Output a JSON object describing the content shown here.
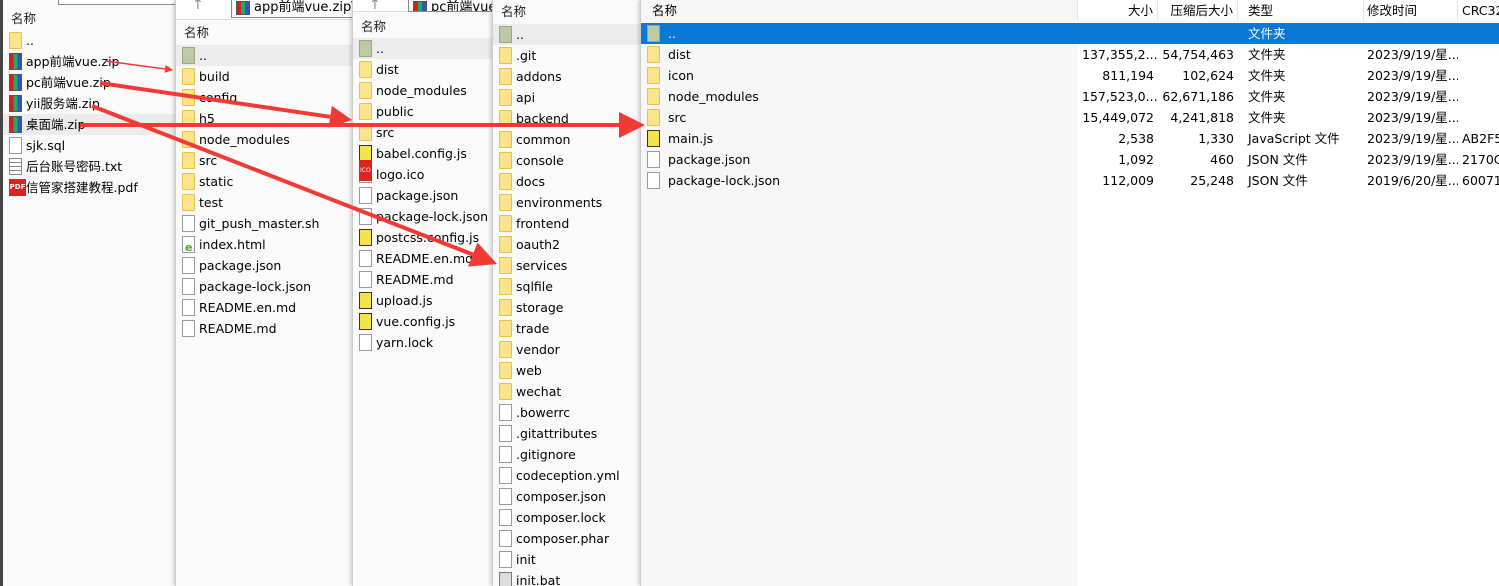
{
  "panels": [
    {
      "header": "名称",
      "items": [
        {
          "name": "..",
          "icon": "up-folder"
        },
        {
          "name": "app前端vue.zip",
          "icon": "zip"
        },
        {
          "name": "pc前端vue.zip",
          "icon": "zip"
        },
        {
          "name": "yii服务端.zip",
          "icon": "zip"
        },
        {
          "name": "桌面端.zip",
          "icon": "zip",
          "highlight": true
        },
        {
          "name": "sjk.sql",
          "icon": "file"
        },
        {
          "name": "后台账号密码.txt",
          "icon": "txt"
        },
        {
          "name": "信管家搭建教程.pdf",
          "icon": "pdf"
        }
      ]
    },
    {
      "header": "名称",
      "address": "app前端vue.zip\\a",
      "items": [
        {
          "name": "..",
          "icon": "up"
        },
        {
          "name": "build",
          "icon": "folder"
        },
        {
          "name": "config",
          "icon": "folder"
        },
        {
          "name": "h5",
          "icon": "folder"
        },
        {
          "name": "node_modules",
          "icon": "folder"
        },
        {
          "name": "src",
          "icon": "folder"
        },
        {
          "name": "static",
          "icon": "folder"
        },
        {
          "name": "test",
          "icon": "folder"
        },
        {
          "name": "git_push_master.sh",
          "icon": "file"
        },
        {
          "name": "index.html",
          "icon": "html"
        },
        {
          "name": "package.json",
          "icon": "file"
        },
        {
          "name": "package-lock.json",
          "icon": "file"
        },
        {
          "name": "README.en.md",
          "icon": "file"
        },
        {
          "name": "README.md",
          "icon": "file"
        }
      ]
    },
    {
      "header": "名称",
      "address": "pc前端vue",
      "items": [
        {
          "name": "..",
          "icon": "up"
        },
        {
          "name": "dist",
          "icon": "folder"
        },
        {
          "name": "node_modules",
          "icon": "folder"
        },
        {
          "name": "public",
          "icon": "folder"
        },
        {
          "name": "src",
          "icon": "folder"
        },
        {
          "name": "babel.config.js",
          "icon": "js"
        },
        {
          "name": "logo.ico",
          "icon": "ico"
        },
        {
          "name": "package.json",
          "icon": "file"
        },
        {
          "name": "package-lock.json",
          "icon": "file"
        },
        {
          "name": "postcss.config.js",
          "icon": "js"
        },
        {
          "name": "README.en.md",
          "icon": "file"
        },
        {
          "name": "README.md",
          "icon": "file"
        },
        {
          "name": "upload.js",
          "icon": "js"
        },
        {
          "name": "vue.config.js",
          "icon": "js"
        },
        {
          "name": "yarn.lock",
          "icon": "file"
        }
      ]
    },
    {
      "header": "名称",
      "items": [
        {
          "name": "..",
          "icon": "up"
        },
        {
          "name": ".git",
          "icon": "folder"
        },
        {
          "name": "addons",
          "icon": "folder"
        },
        {
          "name": "api",
          "icon": "folder"
        },
        {
          "name": "backend",
          "icon": "folder"
        },
        {
          "name": "common",
          "icon": "folder"
        },
        {
          "name": "console",
          "icon": "folder"
        },
        {
          "name": "docs",
          "icon": "folder"
        },
        {
          "name": "environments",
          "icon": "folder"
        },
        {
          "name": "frontend",
          "icon": "folder"
        },
        {
          "name": "oauth2",
          "icon": "folder"
        },
        {
          "name": "services",
          "icon": "folder"
        },
        {
          "name": "sqlfile",
          "icon": "folder"
        },
        {
          "name": "storage",
          "icon": "folder"
        },
        {
          "name": "trade",
          "icon": "folder"
        },
        {
          "name": "vendor",
          "icon": "folder"
        },
        {
          "name": "web",
          "icon": "folder"
        },
        {
          "name": "wechat",
          "icon": "folder"
        },
        {
          "name": ".bowerrc",
          "icon": "file"
        },
        {
          "name": ".gitattributes",
          "icon": "file"
        },
        {
          "name": ".gitignore",
          "icon": "file"
        },
        {
          "name": "codeception.yml",
          "icon": "file"
        },
        {
          "name": "composer.json",
          "icon": "file"
        },
        {
          "name": "composer.lock",
          "icon": "file"
        },
        {
          "name": "composer.phar",
          "icon": "file"
        },
        {
          "name": "init",
          "icon": "file"
        },
        {
          "name": "init.bat",
          "icon": "bat"
        }
      ]
    }
  ],
  "detail": {
    "columns": [
      "名称",
      "大小",
      "压缩后大小",
      "类型",
      "修改时间",
      "CRC32"
    ],
    "rows": [
      [
        "..",
        "",
        "",
        "文件夹",
        "",
        ""
      ],
      [
        "dist",
        "137,355,2...",
        "54,754,463",
        "文件夹",
        "2023/9/19/星...",
        ""
      ],
      [
        "icon",
        "811,194",
        "102,624",
        "文件夹",
        "2023/9/19/星...",
        ""
      ],
      [
        "node_modules",
        "157,523,0...",
        "62,671,186",
        "文件夹",
        "2023/9/19/星...",
        ""
      ],
      [
        "src",
        "15,449,072",
        "4,241,818",
        "文件夹",
        "2023/9/19/星...",
        ""
      ],
      [
        "main.js",
        "2,538",
        "1,330",
        "JavaScript 文件",
        "2023/9/19/星...",
        "AB2F5"
      ],
      [
        "package.json",
        "1,092",
        "460",
        "JSON 文件",
        "2023/9/19/星...",
        "2170C"
      ],
      [
        "package-lock.json",
        "112,009",
        "25,248",
        "JSON 文件",
        "2019/6/20/星...",
        "60071"
      ]
    ],
    "icons": [
      "up",
      "folder",
      "folder",
      "folder",
      "folder",
      "js",
      "file",
      "file"
    ],
    "selected_color": "#0a78d7"
  },
  "arrow_color": "#f23a35"
}
